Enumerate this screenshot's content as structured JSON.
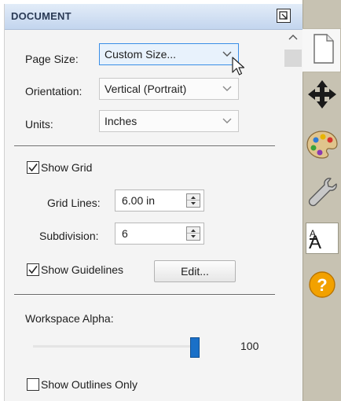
{
  "panel": {
    "title": "DOCUMENT",
    "page_size": {
      "label": "Page Size:",
      "value": "Custom Size..."
    },
    "orientation": {
      "label": "Orientation:",
      "value": "Vertical (Portrait)"
    },
    "units": {
      "label": "Units:",
      "value": "Inches"
    },
    "show_grid": {
      "label": "Show Grid",
      "checked": true
    },
    "grid_lines": {
      "label": "Grid Lines:",
      "value": "6.00 in"
    },
    "subdivision": {
      "label": "Subdivision:",
      "value": "6"
    },
    "show_guidelines": {
      "label": "Show Guidelines",
      "checked": true
    },
    "edit_button": "Edit...",
    "workspace_alpha": {
      "label": "Workspace Alpha:",
      "value": "100",
      "fraction": 1.0
    },
    "show_outlines_only": {
      "label": "Show Outlines Only",
      "checked": false
    }
  },
  "rail": {
    "tabs": [
      {
        "icon": "document-icon",
        "active": true
      },
      {
        "icon": "move-arrows-icon",
        "active": false
      },
      {
        "icon": "palette-icon",
        "active": false
      },
      {
        "icon": "wrench-icon",
        "active": false
      },
      {
        "icon": "text-size-icon",
        "label": "A",
        "label_small": "A",
        "active": false
      },
      {
        "icon": "help-icon",
        "label": "?",
        "active": false
      }
    ]
  },
  "colors": {
    "header_gradient_top": "#e2ecf8",
    "header_gradient_bottom": "#c3d5ee",
    "accent": "#1a70c8",
    "rail": "#c7c2b2",
    "help_orange": "#f2a100"
  }
}
